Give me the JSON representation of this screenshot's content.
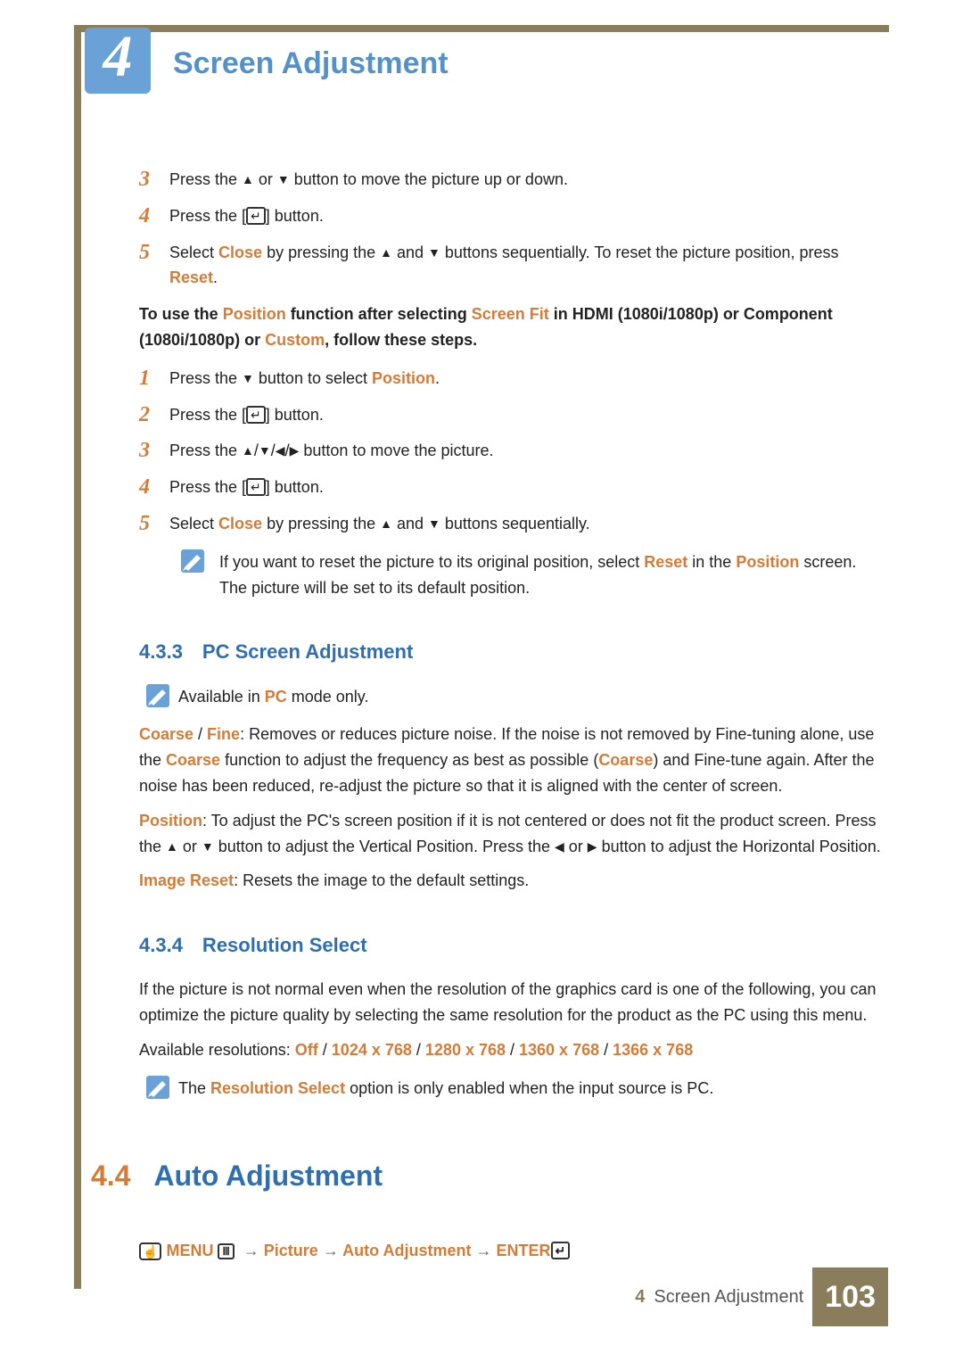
{
  "chapter": {
    "number": "4",
    "title": "Screen Adjustment"
  },
  "section_a_steps": [
    {
      "n": "3",
      "html": "Press the <span class='tri'>▲</span> or <span class='tri'>▼</span> button to move the picture up or down."
    },
    {
      "n": "4",
      "html": "Press the [<span class='icon-enter'>↵</span>] button."
    },
    {
      "n": "5",
      "html": "Select <span class='hl bold'>Close</span> by pressing the <span class='tri'>▲</span> and <span class='tri'>▼</span> buttons sequentially. To reset the picture position, press <span class='hl bold'>Reset</span>."
    }
  ],
  "intro_b": "To use the <span class='hl'>Position</span> function after selecting <span class='hl'>Screen Fit</span> in HDMI (1080i/1080p) or Component (1080i/1080p) or <span class='hl'>Custom</span>, follow these steps.",
  "section_b_steps": [
    {
      "n": "1",
      "html": "Press the <span class='tri'>▼</span> button to select <span class='hl bold'>Position</span>."
    },
    {
      "n": "2",
      "html": "Press the [<span class='icon-enter'>↵</span>] button."
    },
    {
      "n": "3",
      "html": "Press the <span class='tri'>▲</span>/<span class='tri'>▼</span>/<span class='tri'>◀</span>/<span class='tri'>▶</span> button to move the picture."
    },
    {
      "n": "4",
      "html": "Press the [<span class='icon-enter'>↵</span>] button."
    },
    {
      "n": "5",
      "html": "Select <span class='hl bold'>Close</span> by pressing the <span class='tri'>▲</span> and <span class='tri'>▼</span> buttons sequentially."
    }
  ],
  "note_b": "If you want to reset the picture to its original position, select <span class='hl bold'>Reset</span> in the <span class='hl bold'>Position</span> screen. The picture will be set to its default position.",
  "section_433": {
    "heading": "4.3.3 PC Screen Adjustment",
    "note": "Available in <span class='hl bold'>PC</span> mode only.",
    "p1": "<span class='hl bold'>Coarse</span> / <span class='hl bold'>Fine</span>: Removes or reduces picture noise. If the noise is not removed by Fine-tuning alone, use the <span class='hl bold'>Coarse</span> function to adjust the frequency as best as possible (<span class='hl bold'>Coarse</span>) and Fine-tune again. After the noise has been reduced, re-adjust the picture so that it is aligned with the center of screen.",
    "p2": "<span class='hl bold'>Position</span>: To adjust the PC's screen position if it is not centered or does not fit the product screen. Press the <span class='tri'>▲</span> or <span class='tri'>▼</span> button to adjust the Vertical Position. Press the <span class='tri'>◀</span> or <span class='tri'>▶</span> button to adjust the Horizontal Position.",
    "p3": "<span class='hl bold'>Image Reset</span>: Resets the image to the default settings."
  },
  "section_434": {
    "heading": "4.3.4 Resolution Select",
    "p1": "If the picture is not normal even when the resolution of the graphics card is one of the following, you can optimize the picture quality by selecting the same resolution for the product as the PC using this menu.",
    "p2": "Available resolutions: <span class='hl bold'>Off</span> / <span class='hl bold'>1024 x 768</span> / <span class='hl bold'>1280 x 768</span> / <span class='hl bold'>1360 x 768</span> / <span class='hl bold'>1366 x 768</span>",
    "note": "The <span class='hl bold'>Resolution Select</span> option is only enabled when the input source is PC."
  },
  "section_44": {
    "number": "4.4",
    "title": "Auto Adjustment",
    "nav": "<span class='icon-hand'>☝</span> <span class='hl'>MENU</span> <span class='icon-menu'>Ⅲ</span>&nbsp; <span class='arrow-sep'>→</span> <span class='hl'>Picture</span> <span class='arrow-sep'>→</span> <span class='hl'>Auto Adjustment</span> <span class='arrow-sep'>→</span> <span class='hl'>ENTER</span><span class='icon-enter'>↵</span>"
  },
  "footer": {
    "chapnum": "4",
    "chapname": "Screen Adjustment",
    "page": "103"
  }
}
